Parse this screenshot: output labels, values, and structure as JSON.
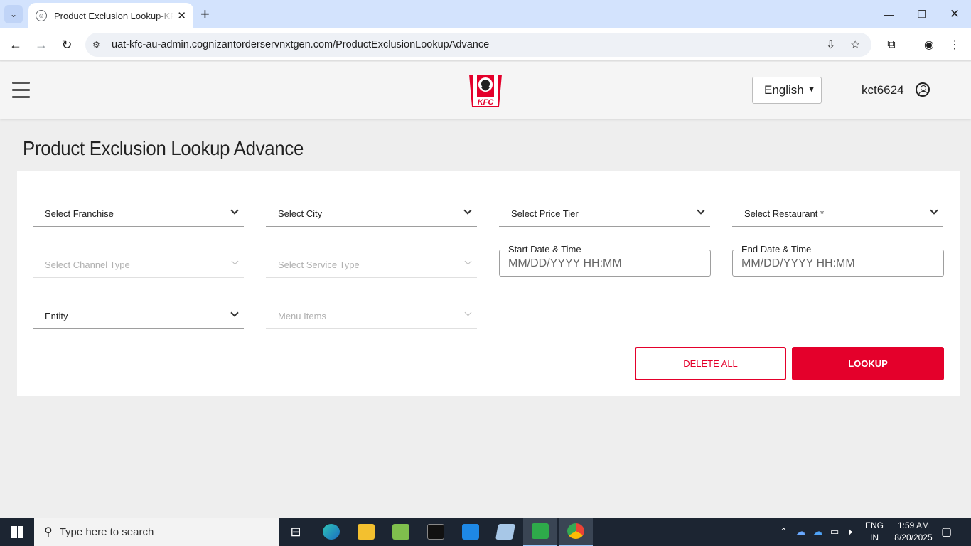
{
  "browser": {
    "tab_title": "Product Exclusion Lookup-KFC-",
    "tab_close": "✕",
    "new_tab": "+",
    "url": "uat-kfc-au-admin.cognizantorderservnxtgen.com/ProductExclusionLookupAdvance"
  },
  "header": {
    "logo_text": "KFC",
    "language": "English",
    "username": "kct6624"
  },
  "page": {
    "title": "Product Exclusion Lookup Advance"
  },
  "filters": {
    "franchise": "Select Franchise",
    "city": "Select City",
    "price_tier": "Select Price Tier",
    "restaurant": "Select Restaurant *",
    "channel_type": "Select Channel Type",
    "service_type": "Select Service Type",
    "entity": "Entity",
    "menu_items": "Menu Items",
    "start_date_label": "Start Date & Time",
    "start_date_placeholder": "MM/DD/YYYY HH:MM",
    "end_date_label": "End Date & Time",
    "end_date_placeholder": "MM/DD/YYYY HH:MM"
  },
  "actions": {
    "delete_all": "DELETE ALL",
    "lookup": "LOOKUP"
  },
  "colors": {
    "brand_red": "#e4002b"
  },
  "taskbar": {
    "search_placeholder": "Type here to search",
    "lang_line1": "ENG",
    "lang_line2": "IN",
    "time": "1:59 AM",
    "date": "8/20/2025"
  }
}
